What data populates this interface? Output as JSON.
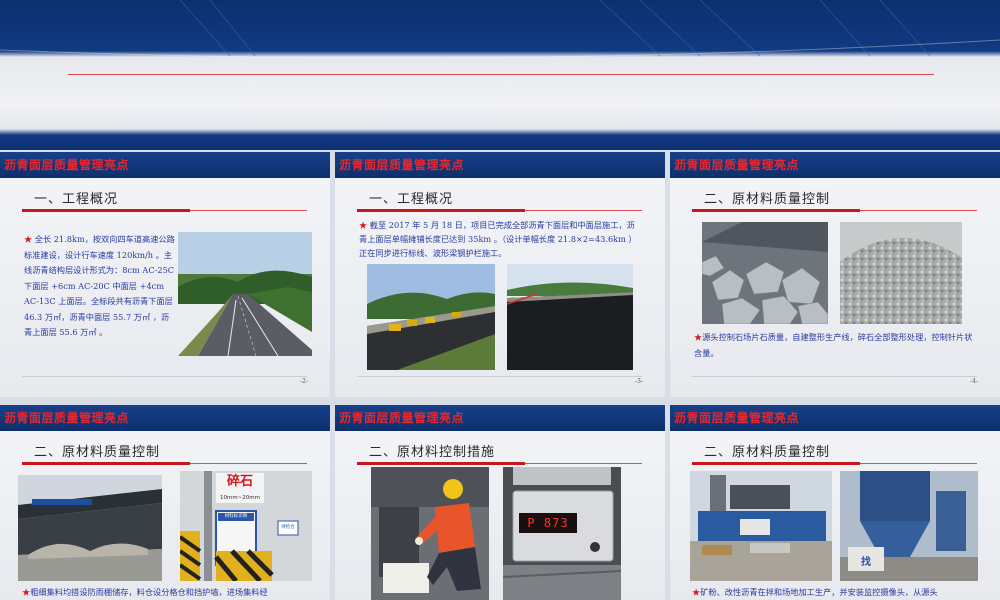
{
  "header_title": "沥青面层质量管理亮点",
  "slides": [
    {
      "section": "一、工程概况",
      "star": "★",
      "text": " 全长 21.8km，按双向四车道高速公路标准建设，设计行车速度 120km/h 。主线沥青结构层设计形式为：8cm AC-25C 下面层 +6cm AC-20C 中面层 +4cm AC-13C 上面层。全标段共有沥青下面层 46.3 万㎡，沥青中面层 55.7 万㎡ ，沥青上面层 55.6 万㎡ 。",
      "page": "-2-"
    },
    {
      "section": "一、工程概况",
      "star": "★",
      "text": " 截至 2017 年 5 月 18 日，项目已完成全部沥青下面层和中面层施工，沥青上面层单幅摊铺长度已达到 35km 。（设计单幅长度 21.8×2=43.6km ）正在同步进行标线、波形梁钢护栏施工。",
      "page": "-3-"
    },
    {
      "section": "二、原材料质量控制",
      "star": "★",
      "text": "源头控制石场片石质量，自建整形生产线，碎石全部整形处理，控制针片状含量。",
      "page": "-4-"
    },
    {
      "section": "二、原材料质量控制",
      "star": "★",
      "text": "粗细集料均搭设防雨棚储存，料仓设分格仓和挡护墙，进场集料经",
      "sign_label": "碎石",
      "sign_sub": "10mm~20mm",
      "sign_board": "材料标识牌",
      "side_sign": "待检仓"
    },
    {
      "section": "二、原材料控制措施",
      "display_reading": "873",
      "display_prefix": "P"
    },
    {
      "section": "二、原材料质量控制",
      "star": "★",
      "text": "矿粉、改性沥青在拌和场地加工生产，并安装监控摄像头，从源头"
    }
  ]
}
